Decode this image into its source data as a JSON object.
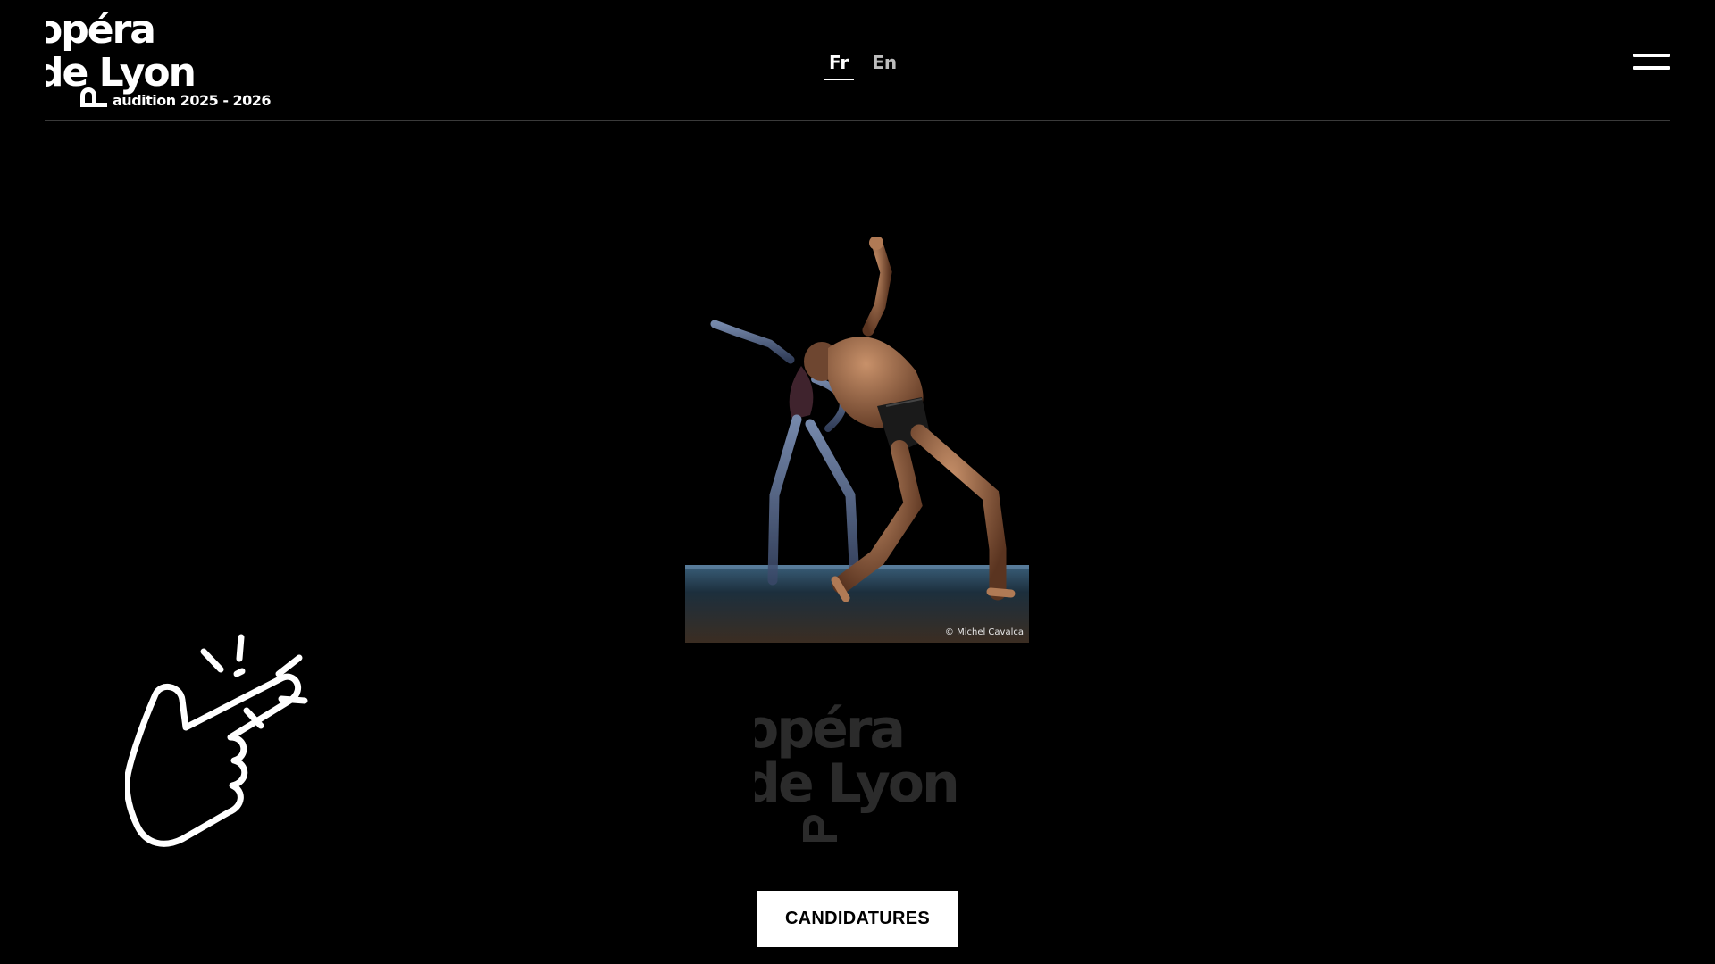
{
  "header": {
    "logo_line1": "opéra",
    "logo_line2": "de Lyon",
    "logo_sub": "audition 2025 - 2026",
    "languages": [
      {
        "label": "Fr",
        "active": true
      },
      {
        "label": "En",
        "active": false
      }
    ],
    "menu_icon": "hamburger-menu-icon"
  },
  "hero": {
    "photo_credit": "© Michel Cavalca",
    "image_subject": "two dancers on stage"
  },
  "watermark_logo": {
    "line1": "opéra",
    "line2": "de Lyon"
  },
  "cta": {
    "label": "CANDIDATURES"
  },
  "decor": {
    "hand_icon": "pointing-hand-click-icon"
  },
  "colors": {
    "background": "#000000",
    "text": "#ffffff",
    "watermark": "#2b2b2b",
    "button_bg": "#ffffff",
    "button_text": "#000000"
  }
}
